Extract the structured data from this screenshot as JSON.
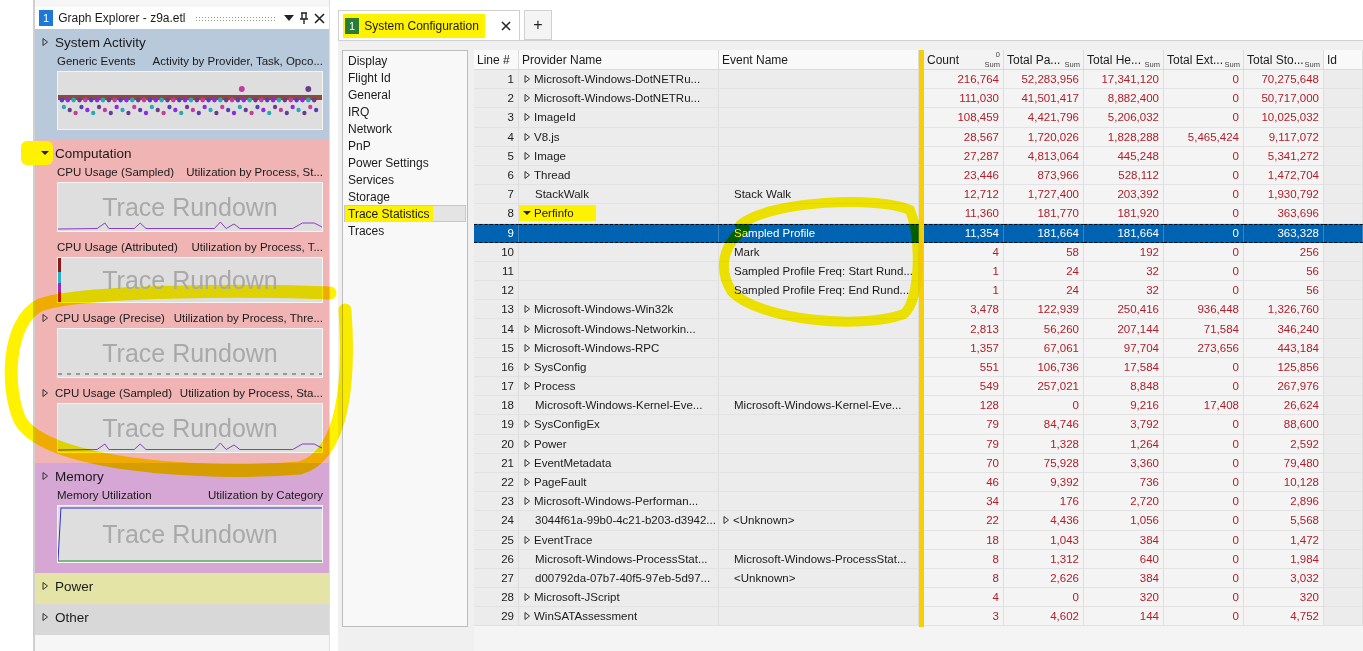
{
  "graph_explorer": {
    "badge": "1",
    "title": "Graph Explorer - z9a.etl",
    "groups": [
      {
        "name": "System Activity",
        "expanded": false,
        "highlighted": false,
        "color": "#b8c9dc",
        "graphs": [
          {
            "kind": "scatter",
            "title": "Generic Events",
            "subtitle": "Activity by Provider, Task, Opco...",
            "collapsible": false
          }
        ]
      },
      {
        "name": "Computation",
        "expanded": true,
        "highlighted": true,
        "color": "#f0b4b4",
        "graphs": [
          {
            "kind": "line",
            "title": "CPU Usage (Sampled)",
            "subtitle": "Utilization by Process, St...",
            "overlay": "Trace Rundown",
            "collapsible": false
          },
          {
            "kind": "strip",
            "title": "CPU Usage (Attributed)",
            "subtitle": "Utilization by Process, T...",
            "overlay": "Trace Rundown",
            "collapsible": false
          },
          {
            "kind": "flat",
            "title": "CPU Usage (Precise)",
            "subtitle": "Utilization by Process, Thre...",
            "overlay": "Trace Rundown",
            "collapsible": true
          },
          {
            "kind": "line",
            "title": "CPU Usage (Sampled)",
            "subtitle": "Utilization by Process, Sta...",
            "overlay": "Trace Rundown",
            "collapsible": true
          }
        ]
      },
      {
        "name": "Memory",
        "expanded": false,
        "highlighted": false,
        "color": "#d6a6d4",
        "graphs": [
          {
            "kind": "memory",
            "title": "Memory Utilization",
            "subtitle": "Utilization by Category",
            "overlay": "Trace Rundown",
            "collapsible": false
          }
        ]
      },
      {
        "name": "Power",
        "expanded": false,
        "highlighted": false,
        "color": "#e4e4a6"
      },
      {
        "name": "Other",
        "expanded": false,
        "highlighted": false,
        "color": "#d8d8d8"
      }
    ]
  },
  "tabs": [
    {
      "badge": "1",
      "label": "System Configuration",
      "selected": true,
      "highlighted": true
    }
  ],
  "new_tab": "+",
  "config_list": [
    {
      "label": "Display",
      "selected": false,
      "highlighted": false
    },
    {
      "label": "Flight Id",
      "selected": false,
      "highlighted": false
    },
    {
      "label": "General",
      "selected": false,
      "highlighted": false
    },
    {
      "label": "IRQ",
      "selected": false,
      "highlighted": false
    },
    {
      "label": "Network",
      "selected": false,
      "highlighted": false
    },
    {
      "label": "PnP",
      "selected": false,
      "highlighted": false
    },
    {
      "label": "Power Settings",
      "selected": false,
      "highlighted": false
    },
    {
      "label": "Services",
      "selected": false,
      "highlighted": false
    },
    {
      "label": "Storage",
      "selected": false,
      "highlighted": false
    },
    {
      "label": "Trace Statistics",
      "selected": true,
      "highlighted": true
    },
    {
      "label": "Traces",
      "selected": false,
      "highlighted": false
    }
  ],
  "table": {
    "columns": [
      {
        "label": "Line #",
        "kind": "key"
      },
      {
        "label": "Provider Name",
        "kind": "key"
      },
      {
        "label": "Event Name",
        "kind": "key"
      },
      {
        "label": "Count",
        "kind": "value",
        "sum": "Sum",
        "sort": "0"
      },
      {
        "label": "Total Pa...",
        "kind": "value",
        "sum": "Sum"
      },
      {
        "label": "Total He...",
        "kind": "value",
        "sum": "Sum"
      },
      {
        "label": "Total Ext...",
        "kind": "value",
        "sum": "Sum"
      },
      {
        "label": "Total Sto...",
        "kind": "value",
        "sum": "Sum"
      },
      {
        "label": "Id",
        "kind": "key"
      }
    ],
    "rows": [
      {
        "line": "1",
        "provider": "Microsoft-Windows-DotNETRu...",
        "has_children": true,
        "expanded": false,
        "event_has_children": false,
        "highlighted": false,
        "values": [
          "216,764",
          "52,283,956",
          "17,341,120",
          "0",
          "70,275,648"
        ],
        "selected": false
      },
      {
        "line": "2",
        "provider": "Microsoft-Windows-DotNETRu...",
        "has_children": true,
        "expanded": false,
        "event_has_children": false,
        "highlighted": false,
        "values": [
          "111,030",
          "41,501,417",
          "8,882,400",
          "0",
          "50,717,000"
        ],
        "selected": false
      },
      {
        "line": "3",
        "provider": "ImageId",
        "has_children": true,
        "expanded": false,
        "event_has_children": false,
        "highlighted": false,
        "values": [
          "108,459",
          "4,421,796",
          "5,206,032",
          "0",
          "10,025,032"
        ],
        "selected": false
      },
      {
        "line": "4",
        "provider": "V8.js",
        "has_children": true,
        "expanded": false,
        "event_has_children": false,
        "highlighted": false,
        "values": [
          "28,567",
          "1,720,026",
          "1,828,288",
          "5,465,424",
          "9,117,072"
        ],
        "selected": false
      },
      {
        "line": "5",
        "provider": "Image",
        "has_children": true,
        "expanded": false,
        "event_has_children": false,
        "highlighted": false,
        "values": [
          "27,287",
          "4,813,064",
          "445,248",
          "0",
          "5,341,272"
        ],
        "selected": false
      },
      {
        "line": "6",
        "provider": "Thread",
        "has_children": true,
        "expanded": false,
        "event_has_children": false,
        "highlighted": false,
        "values": [
          "23,446",
          "873,966",
          "528,112",
          "0",
          "1,472,704"
        ],
        "selected": false
      },
      {
        "line": "7",
        "provider": "StackWalk",
        "has_children": false,
        "event": "Stack Walk",
        "event_has_children": false,
        "highlighted": false,
        "values": [
          "12,712",
          "1,727,400",
          "203,392",
          "0",
          "1,930,792"
        ],
        "selected": false
      },
      {
        "line": "8",
        "provider": "Perfinfo",
        "has_children": true,
        "expanded": true,
        "event_has_children": false,
        "highlighted": true,
        "values": [
          "11,360",
          "181,770",
          "181,920",
          "0",
          "363,696"
        ],
        "selected": false
      },
      {
        "line": "9",
        "has_children": false,
        "event": "Sampled Profile",
        "event_has_children": false,
        "highlighted": false,
        "values": [
          "11,354",
          "181,664",
          "181,664",
          "0",
          "363,328"
        ],
        "selected": true
      },
      {
        "line": "10",
        "has_children": false,
        "event": "Mark",
        "event_has_children": false,
        "highlighted": false,
        "values": [
          "4",
          "58",
          "192",
          "0",
          "256"
        ],
        "selected": false
      },
      {
        "line": "11",
        "has_children": false,
        "event": "Sampled Profile Freq: Start Rund...",
        "event_has_children": false,
        "highlighted": false,
        "values": [
          "1",
          "24",
          "32",
          "0",
          "56"
        ],
        "selected": false
      },
      {
        "line": "12",
        "has_children": false,
        "event": "Sampled Profile Freq: End Rund...",
        "event_has_children": false,
        "highlighted": false,
        "values": [
          "1",
          "24",
          "32",
          "0",
          "56"
        ],
        "selected": false
      },
      {
        "line": "13",
        "provider": "Microsoft-Windows-Win32k",
        "has_children": true,
        "expanded": false,
        "event_has_children": false,
        "highlighted": false,
        "values": [
          "3,478",
          "122,939",
          "250,416",
          "936,448",
          "1,326,760"
        ],
        "selected": false
      },
      {
        "line": "14",
        "provider": "Microsoft-Windows-Networkin...",
        "has_children": true,
        "expanded": false,
        "event_has_children": false,
        "highlighted": false,
        "values": [
          "2,813",
          "56,260",
          "207,144",
          "71,584",
          "346,240"
        ],
        "selected": false
      },
      {
        "line": "15",
        "provider": "Microsoft-Windows-RPC",
        "has_children": true,
        "expanded": false,
        "event_has_children": false,
        "highlighted": false,
        "values": [
          "1,357",
          "67,061",
          "97,704",
          "273,656",
          "443,184"
        ],
        "selected": false
      },
      {
        "line": "16",
        "provider": "SysConfig",
        "has_children": true,
        "expanded": false,
        "event_has_children": false,
        "highlighted": false,
        "values": [
          "551",
          "106,736",
          "17,584",
          "0",
          "125,856"
        ],
        "selected": false
      },
      {
        "line": "17",
        "provider": "Process",
        "has_children": true,
        "expanded": false,
        "event_has_children": false,
        "highlighted": false,
        "values": [
          "549",
          "257,021",
          "8,848",
          "0",
          "267,976"
        ],
        "selected": false
      },
      {
        "line": "18",
        "provider": "Microsoft-Windows-Kernel-Eve...",
        "has_children": false,
        "event": "Microsoft-Windows-Kernel-Eve...",
        "event_has_children": false,
        "highlighted": false,
        "values": [
          "128",
          "0",
          "9,216",
          "17,408",
          "26,624"
        ],
        "selected": false
      },
      {
        "line": "19",
        "provider": "SysConfigEx",
        "has_children": true,
        "expanded": false,
        "event_has_children": false,
        "highlighted": false,
        "values": [
          "79",
          "84,746",
          "3,792",
          "0",
          "88,600"
        ],
        "selected": false
      },
      {
        "line": "20",
        "provider": "Power",
        "has_children": true,
        "expanded": false,
        "event_has_children": false,
        "highlighted": false,
        "values": [
          "79",
          "1,328",
          "1,264",
          "0",
          "2,592"
        ],
        "selected": false
      },
      {
        "line": "21",
        "provider": "EventMetadata",
        "has_children": true,
        "expanded": false,
        "event_has_children": false,
        "highlighted": false,
        "values": [
          "70",
          "75,928",
          "3,360",
          "0",
          "79,480"
        ],
        "selected": false
      },
      {
        "line": "22",
        "provider": "PageFault",
        "has_children": true,
        "expanded": false,
        "event_has_children": false,
        "highlighted": false,
        "values": [
          "46",
          "9,392",
          "736",
          "0",
          "10,128"
        ],
        "selected": false
      },
      {
        "line": "23",
        "provider": "Microsoft-Windows-Performan...",
        "has_children": true,
        "expanded": false,
        "event_has_children": false,
        "highlighted": false,
        "values": [
          "34",
          "176",
          "2,720",
          "0",
          "2,896"
        ],
        "selected": false
      },
      {
        "line": "24",
        "provider": "3044f61a-99b0-4c21-b203-d3942...",
        "has_children": false,
        "event": "<Unknown>",
        "event_has_children": true,
        "highlighted": false,
        "values": [
          "22",
          "4,436",
          "1,056",
          "0",
          "5,568"
        ],
        "selected": false
      },
      {
        "line": "25",
        "provider": "EventTrace",
        "has_children": true,
        "expanded": false,
        "event_has_children": false,
        "highlighted": false,
        "values": [
          "18",
          "1,043",
          "384",
          "0",
          "1,472"
        ],
        "selected": false
      },
      {
        "line": "26",
        "provider": "Microsoft-Windows-ProcessStat...",
        "has_children": false,
        "event": "Microsoft-Windows-ProcessStat...",
        "event_has_children": false,
        "highlighted": false,
        "values": [
          "8",
          "1,312",
          "640",
          "0",
          "1,984"
        ],
        "selected": false
      },
      {
        "line": "27",
        "provider": "d00792da-07b7-40f5-97eb-5d97...",
        "has_children": false,
        "event": "<Unknown>",
        "event_has_children": false,
        "highlighted": false,
        "values": [
          "8",
          "2,626",
          "384",
          "0",
          "3,032"
        ],
        "selected": false
      },
      {
        "line": "28",
        "provider": "Microsoft-JScript",
        "has_children": true,
        "expanded": false,
        "event_has_children": false,
        "highlighted": false,
        "values": [
          "4",
          "0",
          "320",
          "0",
          "320"
        ],
        "selected": false
      },
      {
        "line": "29",
        "provider": "WinSATAssessment",
        "has_children": true,
        "expanded": false,
        "event_has_children": false,
        "highlighted": false,
        "values": [
          "3",
          "4,602",
          "144",
          "0",
          "4,752"
        ],
        "selected": false
      }
    ]
  }
}
